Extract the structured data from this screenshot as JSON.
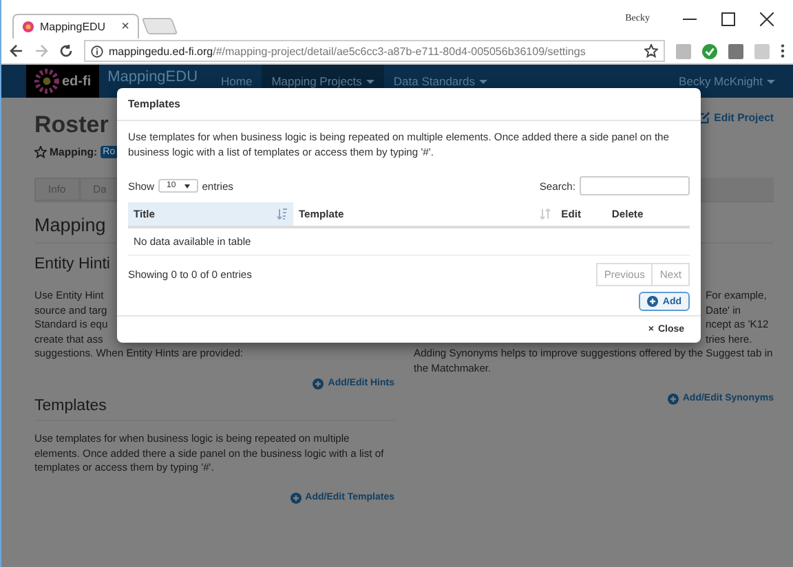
{
  "browser": {
    "window_user": "Becky",
    "tab": {
      "title": "MappingEDU",
      "close": "×"
    },
    "url": {
      "domain": "mappingedu.ed-fi.org",
      "path": "/#/mapping-project/detail/ae5c6cc3-a87b-e711-80d4-005056b36109/settings"
    }
  },
  "navbar": {
    "logo": "ed-fi",
    "brand": "MappingEDU",
    "items": [
      {
        "label": "Home",
        "selected": false,
        "dropdown": false
      },
      {
        "label": "Mapping Projects",
        "selected": true,
        "dropdown": true
      },
      {
        "label": "Data Standards",
        "selected": false,
        "dropdown": true
      }
    ],
    "user": "Becky McKnight"
  },
  "page": {
    "title": "Roster",
    "edit_link": "Edit Project",
    "mapping_label": "Mapping:",
    "mapping_badge": "Ro",
    "tabs": [
      {
        "label": "Info",
        "selected": false
      },
      {
        "label": "Da",
        "selected": false
      }
    ],
    "section_title": "Mapping",
    "left": {
      "title": "Entity Hinti",
      "lines": [
        "Use Entity Hint",
        "source and targ",
        "Standard is equ",
        "create that ass",
        "suggestions. When Entity Hints are provided:"
      ],
      "link": "Add/Edit Hints"
    },
    "right": {
      "fragments": [
        "For example,",
        "Date' in",
        "ncept as 'K12",
        "tries here."
      ],
      "lines": [
        "Adding Synonyms helps to improve suggestions offered by the Suggest tab in",
        "the Matchmaker."
      ],
      "link": "Add/Edit Synonyms"
    },
    "templates": {
      "title": "Templates",
      "text": "Use templates for when business logic is being repeated on multiple elements. Once added there a side panel on the business logic with a list of templates or access them by typing '#'.",
      "link": "Add/Edit Templates"
    }
  },
  "modal": {
    "title": "Templates",
    "text": "Use templates for when business logic is being repeated on multiple elements. Once added there a side panel on the business logic with a list of templates or access them by typing '#'.",
    "length": {
      "before": "Show",
      "value": "10",
      "after": "entries"
    },
    "search_label": "Search:",
    "columns": [
      {
        "label": "Title",
        "sortable": true,
        "sorted": true
      },
      {
        "label": "Template",
        "sortable": true,
        "sorted": false
      },
      {
        "label": "Edit",
        "sortable": false,
        "sorted": false
      },
      {
        "label": "Delete",
        "sortable": false,
        "sorted": false
      }
    ],
    "empty": "No data available in table",
    "info": "Showing 0 to 0 of 0 entries",
    "pages": [
      {
        "label": "Previous",
        "disabled": true
      },
      {
        "label": "Next",
        "disabled": true
      }
    ],
    "add": "Add",
    "close": "Close",
    "close_icon": "×"
  }
}
